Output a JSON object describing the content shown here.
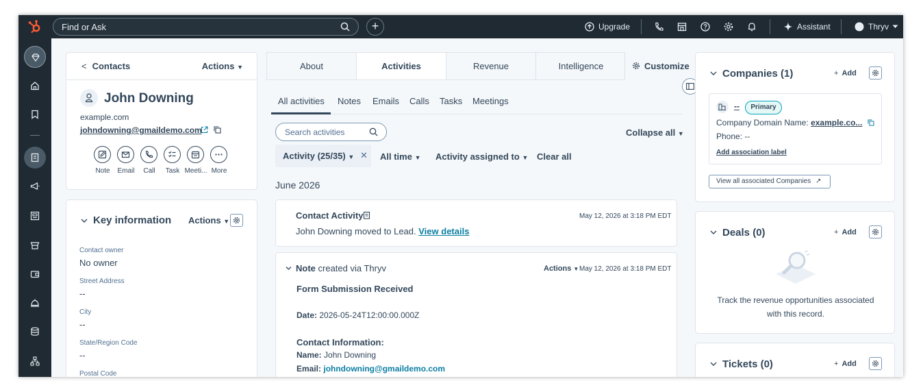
{
  "topbar": {
    "search_placeholder": "Find or Ask",
    "upgrade_label": "Upgrade",
    "assistant_label": "Assistant",
    "account_label": "Thryv"
  },
  "contact_card": {
    "back_label": "Contacts",
    "actions_label": "Actions",
    "name": "John Downing",
    "domain": "example.com",
    "email": "johndowning@gmaildemo.com",
    "quick_actions": [
      {
        "label": "Note",
        "icon": "note-icon"
      },
      {
        "label": "Email",
        "icon": "email-icon"
      },
      {
        "label": "Call",
        "icon": "call-icon"
      },
      {
        "label": "Task",
        "icon": "task-icon"
      },
      {
        "label": "Meeti...",
        "icon": "meeting-icon"
      },
      {
        "label": "More",
        "icon": "more-icon"
      }
    ]
  },
  "key_info": {
    "title": "Key information",
    "actions_label": "Actions",
    "fields": [
      {
        "label": "Contact owner",
        "value": "No owner"
      },
      {
        "label": "Street Address",
        "value": "--"
      },
      {
        "label": "City",
        "value": "--"
      },
      {
        "label": "State/Region Code",
        "value": "--"
      },
      {
        "label": "Postal Code",
        "value": ""
      }
    ]
  },
  "main_tabs": [
    "About",
    "Activities",
    "Revenue",
    "Intelligence"
  ],
  "active_tab": "Activities",
  "customize_label": "Customize",
  "sub_tabs": [
    "All activities",
    "Notes",
    "Emails",
    "Calls",
    "Tasks",
    "Meetings"
  ],
  "activity_search_placeholder": "Search activities",
  "collapse_all_label": "Collapse all",
  "filters": {
    "activity_chip": "Activity (25/35)",
    "time": "All time",
    "assigned": "Activity assigned to",
    "clear": "Clear all"
  },
  "month": "June 2026",
  "activity1": {
    "title": "Contact Activity",
    "time": "May 12, 2026 at 3:18 PM EDT",
    "text": "John Downing moved to Lead.",
    "link": "View details"
  },
  "activity2": {
    "type": "Note",
    "source": "created via Thryv",
    "actions_label": "Actions",
    "time": "May 12, 2026 at 3:18 PM EDT",
    "heading": "Form Submission Received",
    "date_label": "Date:",
    "date_value": "2026-05-24T12:00:00.000Z",
    "contact_info_label": "Contact Information:",
    "name_label": "Name:",
    "name_value": "John Downing",
    "email_label": "Email:",
    "email_value": "johndowning@gmaildemo.com"
  },
  "companies": {
    "title": "Companies (1)",
    "add_label": "Add",
    "company_name": "--",
    "primary_label": "Primary",
    "domain_label": "Company Domain Name:",
    "domain_value": "example.co...",
    "phone_label": "Phone:",
    "phone_value": "--",
    "association_label": "Add association label",
    "view_all_label": "View all associated Companies"
  },
  "deals": {
    "title": "Deals (0)",
    "add_label": "Add",
    "empty_line1": "Track the revenue opportunities associated",
    "empty_line2": "with this record."
  },
  "tickets": {
    "title": "Tickets (0)",
    "add_label": "Add"
  },
  "colors": {
    "nav_dark": "#1f2a33",
    "text": "#33475b",
    "link_teal": "#0b7ea3",
    "border": "#dfe3eb",
    "logo_orange": "#ff5c35"
  }
}
